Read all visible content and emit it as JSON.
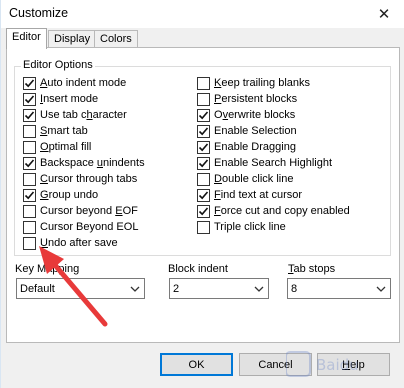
{
  "window": {
    "title": "Customize",
    "close_glyph": "✕"
  },
  "tabs": [
    {
      "label": "Editor",
      "active": true
    },
    {
      "label": "Display",
      "active": false
    },
    {
      "label": "Colors",
      "active": false
    }
  ],
  "editor_options": {
    "legend": "Editor Options",
    "left_column": [
      {
        "pre": "",
        "ul": "A",
        "post": "uto indent mode",
        "checked": true
      },
      {
        "pre": "",
        "ul": "I",
        "post": "nsert mode",
        "checked": true
      },
      {
        "pre": "Use tab c",
        "ul": "h",
        "post": "aracter",
        "checked": true
      },
      {
        "pre": "",
        "ul": "S",
        "post": "mart tab",
        "checked": false
      },
      {
        "pre": "",
        "ul": "O",
        "post": "ptimal fill",
        "checked": false
      },
      {
        "pre": "Backspace ",
        "ul": "u",
        "post": "nindents",
        "checked": true
      },
      {
        "pre": "",
        "ul": "C",
        "post": "ursor through tabs",
        "checked": false
      },
      {
        "pre": "",
        "ul": "G",
        "post": "roup undo",
        "checked": true
      },
      {
        "pre": "Cursor beyond ",
        "ul": "E",
        "post": "OF",
        "checked": false
      },
      {
        "pre": "Cursor Beyond EOL",
        "ul": "",
        "post": "",
        "checked": false
      },
      {
        "pre": "",
        "ul": "U",
        "post": "ndo after save",
        "checked": false
      }
    ],
    "right_column": [
      {
        "pre": "",
        "ul": "K",
        "post": "eep trailing blanks",
        "checked": false
      },
      {
        "pre": "",
        "ul": "P",
        "post": "ersistent blocks",
        "checked": false
      },
      {
        "pre": "O",
        "ul": "v",
        "post": "erwrite blocks",
        "checked": true
      },
      {
        "pre": "Enable Selection",
        "ul": "",
        "post": "",
        "checked": true
      },
      {
        "pre": "Enable Dragging",
        "ul": "",
        "post": "",
        "checked": true
      },
      {
        "pre": "Enable Search Highlight",
        "ul": "",
        "post": "",
        "checked": true
      },
      {
        "pre": "",
        "ul": "D",
        "post": "ouble click line",
        "checked": false
      },
      {
        "pre": "",
        "ul": "F",
        "post": "ind text at cursor",
        "checked": true
      },
      {
        "pre": "",
        "ul": "F",
        "post": "orce cut and copy enabled",
        "checked": true
      },
      {
        "pre": "Triple click line",
        "ul": "",
        "post": "",
        "checked": false
      }
    ]
  },
  "key_mapping": {
    "label": "Key Mapping",
    "value": "Default"
  },
  "block_indent": {
    "label": "Block indent",
    "value": "2"
  },
  "tab_stops": {
    "pre": "",
    "ul": "T",
    "post": "ab stops",
    "value": "8"
  },
  "buttons": {
    "ok": "OK",
    "cancel": "Cancel",
    "help_pre": "",
    "help_ul": "H",
    "help_post": "elp"
  },
  "annotation_color": "#e83a3a",
  "icons": {
    "close": "close-icon",
    "check": "checkmark-icon",
    "dropdown": "chevron-down-icon",
    "arrow": "red-arrow-annotation"
  }
}
